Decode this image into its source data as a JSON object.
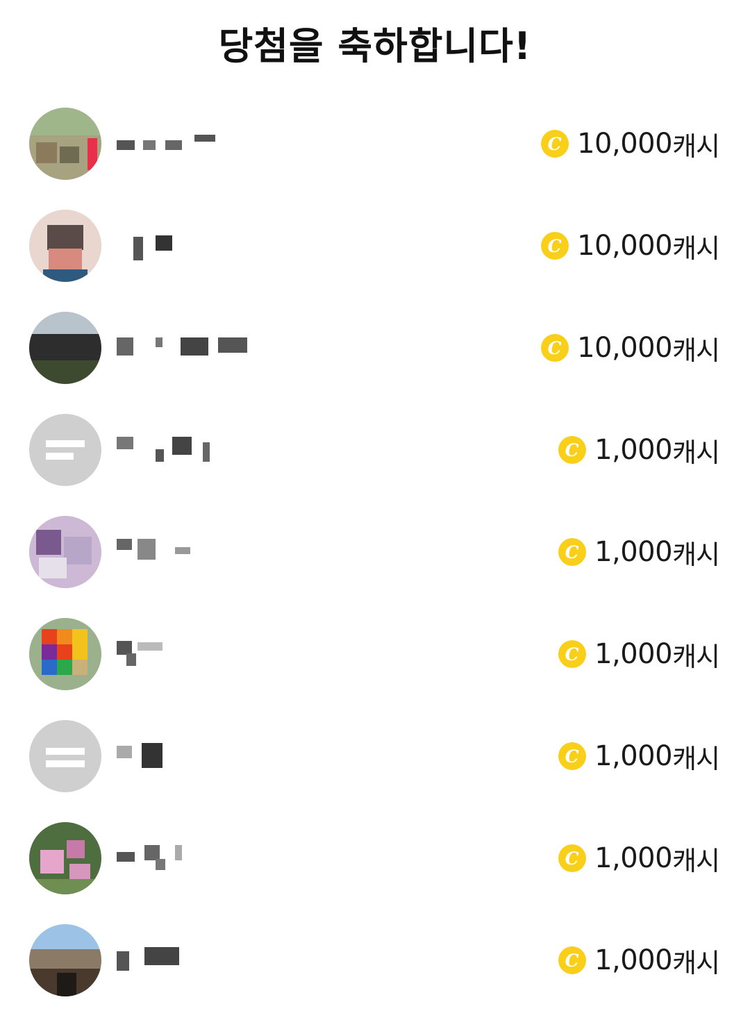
{
  "header": {
    "title": "당첨을 축하합니다!"
  },
  "winners": [
    {
      "reward": "10,000",
      "unit": "캐시",
      "avatar": "photo-avatar"
    },
    {
      "reward": "10,000",
      "unit": "캐시",
      "avatar": "photo-avatar"
    },
    {
      "reward": "10,000",
      "unit": "캐시",
      "avatar": "photo-avatar"
    },
    {
      "reward": "1,000",
      "unit": "캐시",
      "avatar": "default-avatar"
    },
    {
      "reward": "1,000",
      "unit": "캐시",
      "avatar": "photo-avatar"
    },
    {
      "reward": "1,000",
      "unit": "캐시",
      "avatar": "photo-avatar"
    },
    {
      "reward": "1,000",
      "unit": "캐시",
      "avatar": "default-avatar"
    },
    {
      "reward": "1,000",
      "unit": "캐시",
      "avatar": "photo-avatar"
    },
    {
      "reward": "1,000",
      "unit": "캐시",
      "avatar": "photo-avatar"
    }
  ],
  "coin_icon": {
    "name": "cash-coin-icon",
    "glyph": "C",
    "color": "#f9cf1a"
  },
  "colors": {
    "background": "#ffffff",
    "text": "#1a1a1a",
    "default_avatar": "#cfcfcf"
  }
}
